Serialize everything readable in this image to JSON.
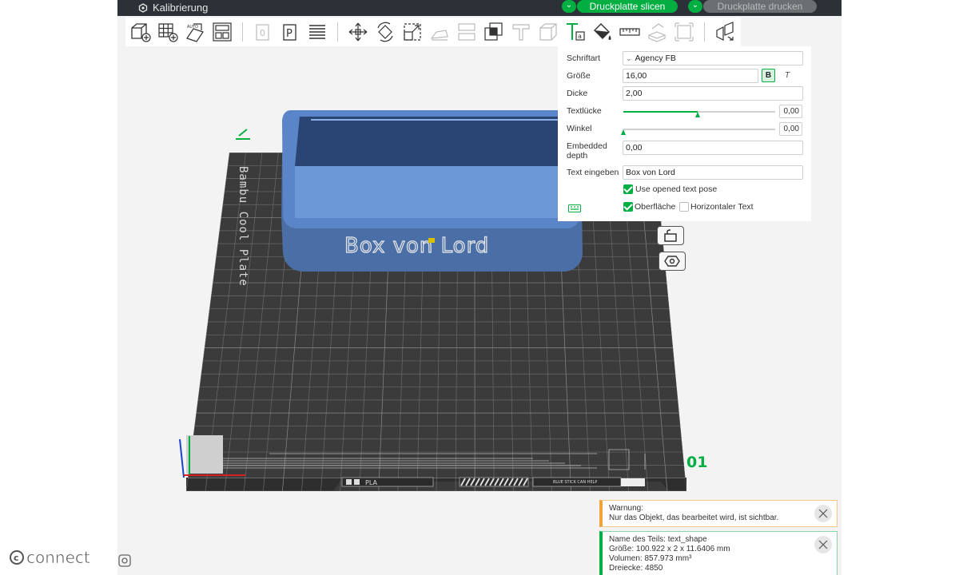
{
  "topbar": {
    "calibration_label": "Kalibrierung",
    "slice_label": "Druckplatte slicen",
    "print_label": "Druckplatte drucken"
  },
  "toolbar": {
    "icons": [
      "add-object-icon",
      "add-grid-icon",
      "auto-orient-icon",
      "arrange-icon",
      "clone-icon",
      "plate-icon",
      "layers-icon",
      "move-icon",
      "rotate-icon",
      "scale-icon",
      "lay-on-face-icon",
      "cut-icon",
      "boolean-icon",
      "support-icon",
      "seam-icon",
      "text-tool-icon",
      "paint-icon",
      "measure-icon",
      "assembly-icon",
      "fit-icon",
      "explode-icon"
    ]
  },
  "text_panel": {
    "font_label": "Schriftart",
    "font_value": "Agency FB",
    "size_label": "Größe",
    "size_value": "16,00",
    "bold_label": "B",
    "italic_label": "T",
    "thickness_label": "Dicke",
    "thickness_value": "2,00",
    "gap_label": "Textlücke",
    "gap_value": "0,00",
    "angle_label": "Winkel",
    "angle_value": "0,00",
    "embedded_label_1": "Embedded",
    "embedded_label_2": "depth",
    "embedded_value": "0,00",
    "text_label": "Text eingeben",
    "text_value": "Box von Lord",
    "use_pose_label": "Use opened text pose",
    "use_pose_checked": true,
    "surface_label": "Oberfläche",
    "surface_checked": true,
    "horizontal_label": "Horizontaler Text",
    "horizontal_checked": false,
    "gap_slider_fraction": 0.49,
    "angle_slider_fraction": 0.0
  },
  "scene": {
    "box_text": "Box von Lord",
    "plate_side_label": "Bambu Cool Plate",
    "plate_number": "01",
    "plate_bottom_label": "PLA",
    "plate_bottom_note": "BLUE STICK CAN HELP"
  },
  "notifications": {
    "warning_title": "Warnung:",
    "warning_text": "Nur das Objekt, das bearbeitet wird, ist sichtbar.",
    "info_name": "Name des Teils: text_shape",
    "info_size": "Größe: 100.922 x 2 x 11.6406 mm",
    "info_volume": "Volumen: 857.973 mm³",
    "info_triangles": "Dreiecke: 4850"
  },
  "watermark": {
    "text": "connect"
  },
  "colors": {
    "accent": "#00ae42",
    "topbar": "#2b3136",
    "plate": "#3c3c3c",
    "box": "#4f71a6",
    "warning": "#f2a23a"
  }
}
